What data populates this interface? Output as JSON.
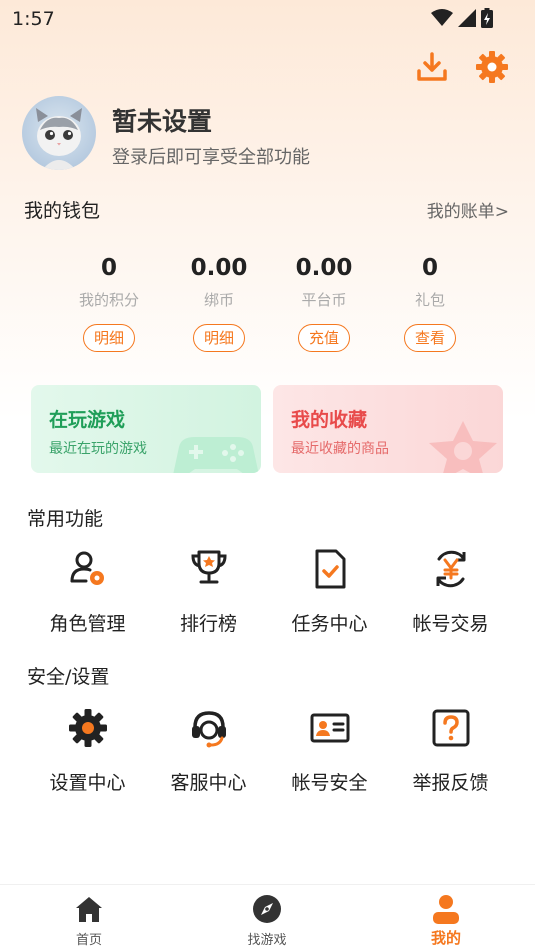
{
  "status_bar": {
    "time": "1:57"
  },
  "colors": {
    "accent": "#f5781f",
    "green": "#1f9e58",
    "red": "#e84b4b"
  },
  "top_actions": [
    {
      "icon": "download-icon"
    },
    {
      "icon": "gear-icon"
    }
  ],
  "profile": {
    "name": "暂未设置",
    "subtitle": "登录后即可享受全部功能"
  },
  "wallet": {
    "title": "我的钱包",
    "bill_link": "我的账单>",
    "items": [
      {
        "value": "0",
        "label": "我的积分",
        "button": "明细"
      },
      {
        "value": "0.00",
        "label": "绑币",
        "button": "明细"
      },
      {
        "value": "0.00",
        "label": "平台币",
        "button": "充值"
      },
      {
        "value": "0",
        "label": "礼包",
        "button": "查看"
      }
    ]
  },
  "cards": [
    {
      "title": "在玩游戏",
      "subtitle": "最近在玩的游戏",
      "icon": "gamepad-icon"
    },
    {
      "title": "我的收藏",
      "subtitle": "最近收藏的商品",
      "icon": "star-icon"
    }
  ],
  "common": {
    "title": "常用功能",
    "items": [
      {
        "label": "角色管理",
        "icon": "role-manage-icon"
      },
      {
        "label": "排行榜",
        "icon": "trophy-icon"
      },
      {
        "label": "任务中心",
        "icon": "task-icon"
      },
      {
        "label": "帐号交易",
        "icon": "yuan-exchange-icon"
      }
    ]
  },
  "security": {
    "title": "安全/设置",
    "items": [
      {
        "label": "设置中心",
        "icon": "gear-icon"
      },
      {
        "label": "客服中心",
        "icon": "headset-icon"
      },
      {
        "label": "帐号安全",
        "icon": "id-card-icon"
      },
      {
        "label": "举报反馈",
        "icon": "question-icon"
      }
    ]
  },
  "tabs": [
    {
      "label": "首页",
      "icon": "home-icon",
      "active": false
    },
    {
      "label": "找游戏",
      "icon": "compass-icon",
      "active": false
    },
    {
      "label": "我的",
      "icon": "user-icon",
      "active": true
    }
  ]
}
